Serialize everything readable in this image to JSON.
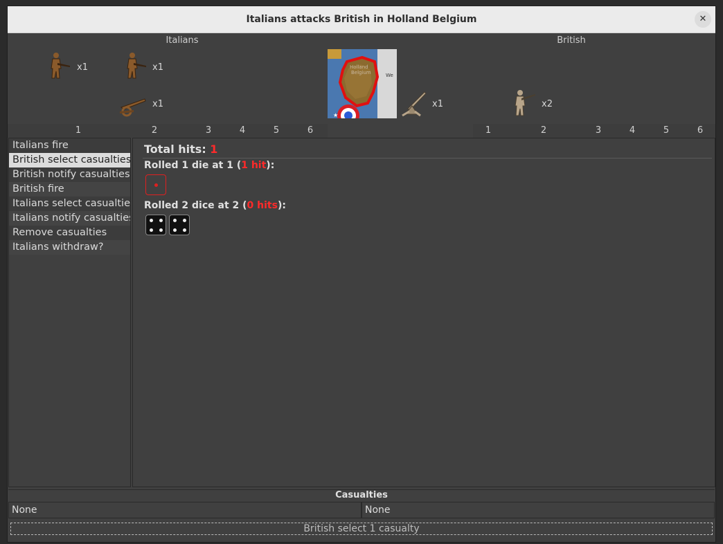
{
  "window": {
    "title": "Italians attacks British in Holland Belgium",
    "close_glyph": "✕"
  },
  "attacker": {
    "name": "Italians",
    "units": [
      {
        "type": "infantry",
        "count": "x1"
      },
      {
        "type": "infantry",
        "count": "x1"
      },
      {
        "type": "artillery",
        "count": "x1"
      }
    ],
    "colors": {
      "unit": "#8a5a2b"
    }
  },
  "defender": {
    "name": "British",
    "units": [
      {
        "type": "anti-aircraft",
        "count": "x1"
      },
      {
        "type": "infantry",
        "count": "x2"
      }
    ],
    "colors": {
      "unit": "#b8a58a"
    }
  },
  "territory": {
    "label_line1": "Holland",
    "label_line2": "Belgium",
    "neighbor_label": "We"
  },
  "dice_columns": {
    "attacker": [
      "1",
      "2",
      "3",
      "4",
      "5",
      "6"
    ],
    "defender": [
      "1",
      "2",
      "3",
      "4",
      "5",
      "6"
    ]
  },
  "steps": [
    "Italians fire",
    "British select casualties",
    "British notify casualties",
    "British fire",
    "Italians select casualties",
    "Italians notify casualties",
    "Remove casualties",
    "Italians withdraw?"
  ],
  "selected_step_index": 1,
  "results": {
    "total_label": "Total hits: ",
    "total_value": "1",
    "roll1_prefix": "Rolled 1 die at 1 (",
    "roll1_hits": "1 hit",
    "roll1_suffix": "):",
    "roll2_prefix": "Rolled 2 dice at 2 (",
    "roll2_hits": "0 hits",
    "roll2_suffix": "):"
  },
  "casualties": {
    "header": "Casualties",
    "attacker": "None",
    "defender": "None"
  },
  "status_button": "British select 1 casualty",
  "colors": {
    "hit": "#ff2a2a",
    "territory_border": "#e01010",
    "selected_step": "#dcdcdc"
  }
}
